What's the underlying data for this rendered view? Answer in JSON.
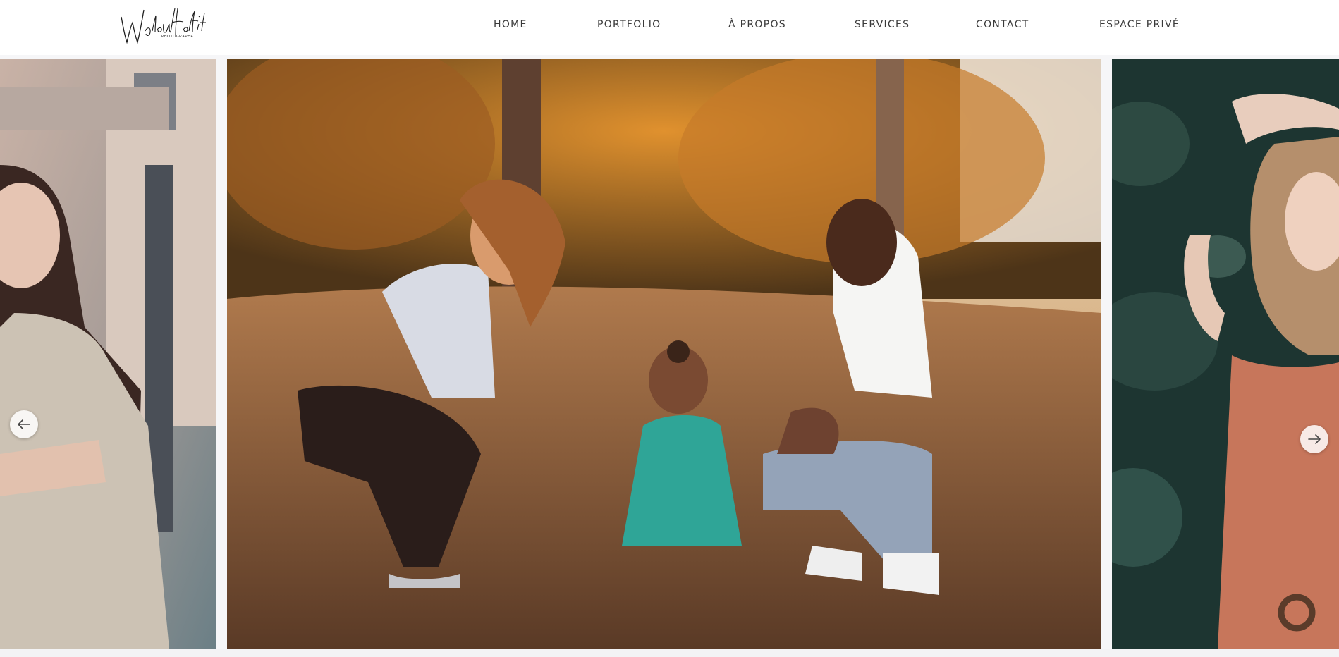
{
  "header": {
    "logo": {
      "script_text": "Waleed Hafid",
      "sub_text": "PHOTOGRAPHE"
    },
    "nav": [
      {
        "label": "HOME"
      },
      {
        "label": "PORTFOLIO"
      },
      {
        "label": "À PROPOS"
      },
      {
        "label": "SERVICES"
      },
      {
        "label": "CONTACT"
      },
      {
        "label": "ESPACE PRIVÉ"
      }
    ]
  },
  "slider": {
    "slides": [
      {
        "subject": "woman in beige dress portrait"
      },
      {
        "subject": "family crouching with toddler in park at sunset"
      },
      {
        "subject": "woman with glasses and terracotta dress against ivy"
      }
    ],
    "prev_icon": "arrow-left-icon",
    "next_icon": "arrow-right-icon"
  },
  "colors": {
    "header_bg": "#ffffff",
    "page_bg": "#f6f6f8",
    "nav_text": "#3a3a3a"
  }
}
